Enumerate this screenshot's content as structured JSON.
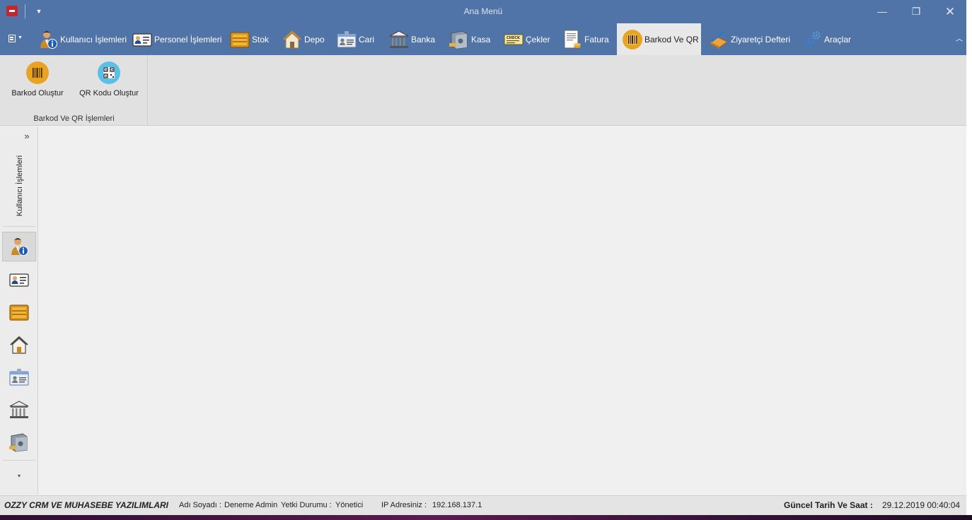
{
  "window": {
    "title": "Ana Menü",
    "controls": {
      "minimize": "—",
      "maximize": "❐",
      "close": "✕"
    }
  },
  "ribbon": {
    "tabs": [
      {
        "label": "Kullanıcı İşlemleri",
        "icon": "user-info-icon"
      },
      {
        "label": "Personel İşlemleri",
        "icon": "id-card-icon"
      },
      {
        "label": "Stok",
        "icon": "stock-crate-icon"
      },
      {
        "label": "Depo",
        "icon": "warehouse-house-icon"
      },
      {
        "label": "Cari",
        "icon": "contact-card-icon"
      },
      {
        "label": "Banka",
        "icon": "bank-building-icon"
      },
      {
        "label": "Kasa",
        "icon": "safe-icon"
      },
      {
        "label": "Çekler",
        "icon": "check-icon"
      },
      {
        "label": "Fatura",
        "icon": "invoice-icon"
      },
      {
        "label": "Barkod Ve QR",
        "icon": "barcode-icon",
        "active": true
      },
      {
        "label": "Ziyaretçi Defteri",
        "icon": "guestbook-icon"
      },
      {
        "label": "Araçlar",
        "icon": "tools-gears-icon"
      }
    ],
    "active_tab": "Barkod Ve QR",
    "page": {
      "group_label": "Barkod Ve QR İşlemleri",
      "buttons": [
        {
          "label": "Barkod Oluştur",
          "icon": "barcode-icon"
        },
        {
          "label": "QR Kodu Oluştur",
          "icon": "qr-code-icon"
        }
      ]
    }
  },
  "navbar": {
    "group_title": "Kullanıcı İşlemleri",
    "expand_glyph": "»",
    "more_glyph": "▾",
    "items": [
      {
        "icon": "user-info-icon",
        "active": true
      },
      {
        "icon": "id-card-icon"
      },
      {
        "icon": "stock-crate-icon"
      },
      {
        "icon": "warehouse-house-icon"
      },
      {
        "icon": "contact-card-icon"
      },
      {
        "icon": "bank-building-icon"
      },
      {
        "icon": "safe-icon"
      }
    ]
  },
  "statusbar": {
    "brand": "OZZY CRM VE MUHASEBE YAZILIMLARI",
    "name_label": "Adı Soyadı :",
    "name_value": "Deneme Admin",
    "role_label": "Yetki Durumu :",
    "role_value": "Yönetici",
    "ip_label": "IP Adresiniz :",
    "ip_value": "192.168.137.1",
    "datetime_label": "Güncel Tarih Ve Saat :",
    "datetime_value": "29.12.2019 00:40:04"
  },
  "colors": {
    "title_bar": "#5174a8",
    "ribbon_page": "#e1e1e1",
    "workspace": "#f0f0f0",
    "app_logo": "#c4262e"
  }
}
